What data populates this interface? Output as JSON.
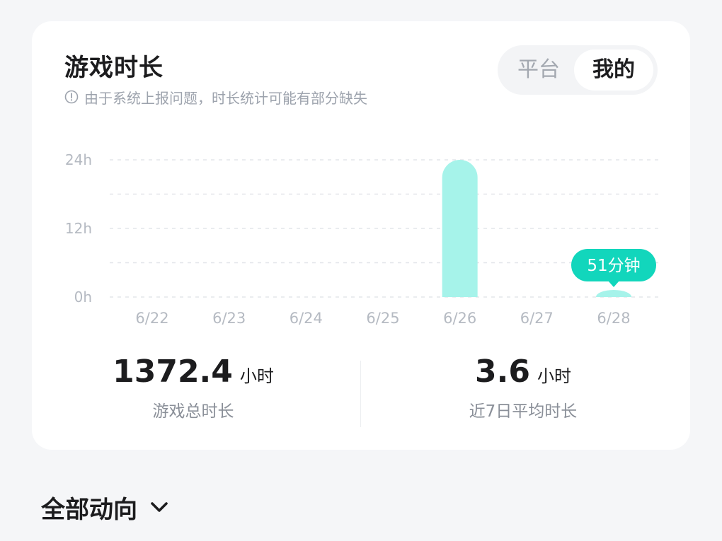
{
  "card": {
    "title": "游戏时长",
    "notice": "由于系统上报问题，时长统计可能有部分缺失",
    "notice_icon": "info-circle-icon",
    "toggle": {
      "options": [
        "平台",
        "我的"
      ],
      "selected": "我的"
    }
  },
  "chart_data": {
    "type": "bar",
    "categories": [
      "6/22",
      "6/23",
      "6/24",
      "6/25",
      "6/26",
      "6/27",
      "6/28"
    ],
    "values": [
      0,
      0,
      0,
      0,
      24,
      0,
      0.85
    ],
    "yticks": [
      "24h",
      "12h",
      "0h"
    ],
    "ylim": [
      0,
      24
    ],
    "grid": true,
    "bar_color": "#a6f3ea",
    "tooltip": {
      "category": "6/28",
      "text": "51分钟",
      "color": "#12d6bc"
    }
  },
  "stats": {
    "total": {
      "value": "1372.4",
      "unit": "小时",
      "label": "游戏总时长"
    },
    "avg": {
      "value": "3.6",
      "unit": "小时",
      "label": "近7日平均时长"
    }
  },
  "section": {
    "title": "全部动向",
    "icon": "chevron-down-icon"
  }
}
